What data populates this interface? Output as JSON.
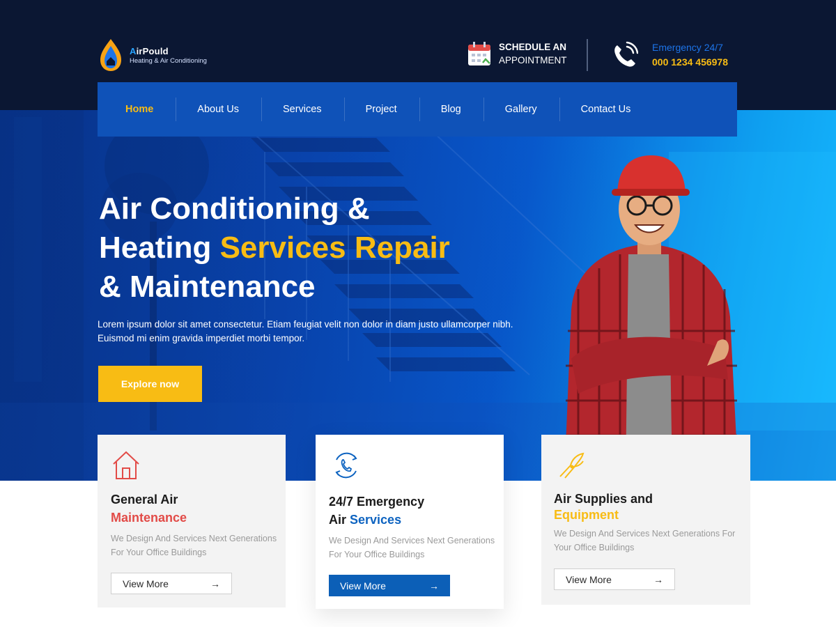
{
  "header": {
    "logo": {
      "name_initial": "A",
      "name_rest": "irPould",
      "tagline": "Heating & Air Conditioning"
    },
    "schedule": {
      "line1": "SCHEDULE AN",
      "line2": "APPOINTMENT"
    },
    "emergency": {
      "label": "Emergency 24/7",
      "phone": "000 1234 456978"
    }
  },
  "nav": {
    "items": [
      {
        "label": "Home",
        "active": true
      },
      {
        "label": "About Us"
      },
      {
        "label": "Services"
      },
      {
        "label": "Project"
      },
      {
        "label": "Blog"
      },
      {
        "label": "Gallery"
      },
      {
        "label": "Contact Us"
      }
    ]
  },
  "hero": {
    "title_line1": "Air Conditioning &",
    "title_line2_white": "Heating ",
    "title_line2_yellow": "Services Repair",
    "title_line3": "& Maintenance",
    "lead": "Lorem ipsum dolor sit amet consectetur. Etiam feugiat velit non dolor in diam justo ullamcorper nibh. Euismod mi enim gravida imperdiet morbi tempor.",
    "cta_label": "Explore now"
  },
  "cards": [
    {
      "icon": "house-icon",
      "title_dark": "General Air",
      "title_accent": "Maintenance",
      "desc": "We Design And Services Next Generations For Your Office Buildings",
      "button": "View More",
      "arrow": "→"
    },
    {
      "icon": "phone-sync-icon",
      "title_dark": "24/7 Emergency",
      "title_dark2": "Air ",
      "title_accent": "Services",
      "desc": "We Design And Services Next Generations For Your Office Buildings",
      "button": "View More",
      "arrow": "→"
    },
    {
      "icon": "pliers-icon",
      "title_dark": "Air Supplies and",
      "title_accent": "Equipment",
      "desc": "We Design And Services Next Generations For Your Office Buildings",
      "button": "View More",
      "arrow": "→"
    }
  ],
  "colors": {
    "accent_yellow": "#f8bc14",
    "nav_blue": "#0f52b8",
    "header_dark": "#0b1733",
    "red_accent": "#e24b47",
    "blue_accent": "#0d63c0"
  }
}
